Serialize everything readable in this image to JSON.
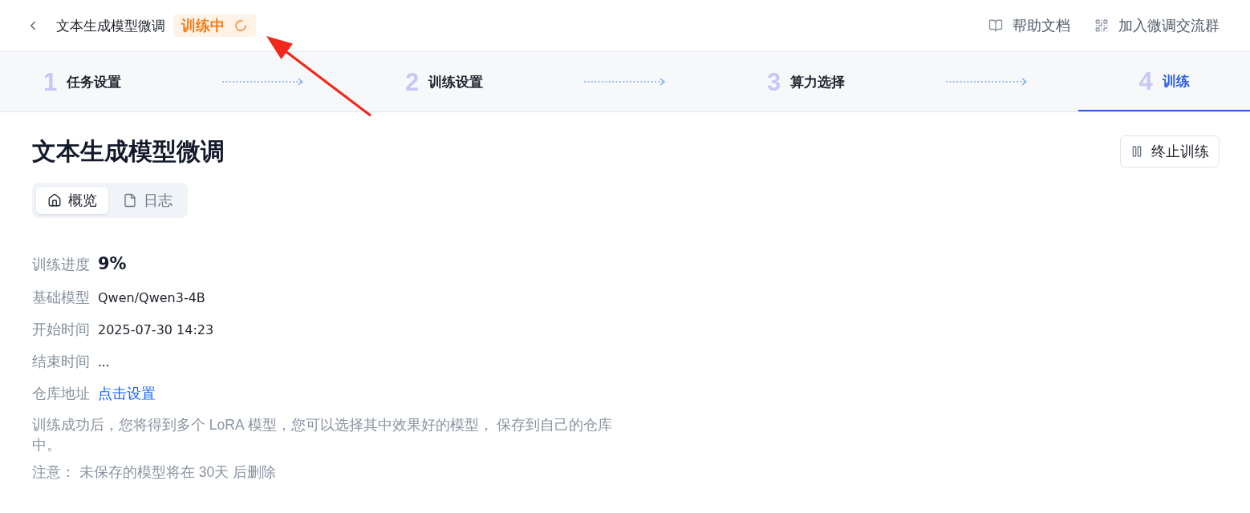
{
  "header": {
    "title": "文本生成模型微调",
    "status": {
      "label": "训练中",
      "loading": true
    },
    "links": [
      {
        "label": "帮助文档"
      },
      {
        "label": "加入微调交流群"
      }
    ]
  },
  "steps": [
    {
      "number": "1",
      "label": "任务设置",
      "selected": false
    },
    {
      "number": "2",
      "label": "训练设置",
      "selected": false
    },
    {
      "number": "3",
      "label": "算力选择",
      "selected": false
    },
    {
      "number": "4",
      "label": "训练",
      "selected": true
    }
  ],
  "page": {
    "title": "文本生成模型微调",
    "action_button": "终止训练"
  },
  "view_tabs": [
    {
      "label": "概览",
      "selected": true
    },
    {
      "label": "日志",
      "selected": false
    }
  ],
  "details": [
    {
      "label": "训练进度",
      "value": "9%",
      "kind": "progress"
    },
    {
      "label": "基础模型",
      "value": "Qwen/Qwen3-4B",
      "kind": "text"
    },
    {
      "label": "开始时间",
      "value": "2025-07-30 14:23",
      "kind": "text"
    },
    {
      "label": "结束时间",
      "value": "...",
      "kind": "text"
    },
    {
      "label": "仓库地址",
      "value": "点击设置",
      "kind": "link"
    }
  ],
  "notes": [
    "训练成功后，您将得到多个 LoRA 模型，您可以选择其中效果好的模型， 保存到自己的仓库中。",
    "注意： 未保存的模型将在 30天 后删除"
  ]
}
